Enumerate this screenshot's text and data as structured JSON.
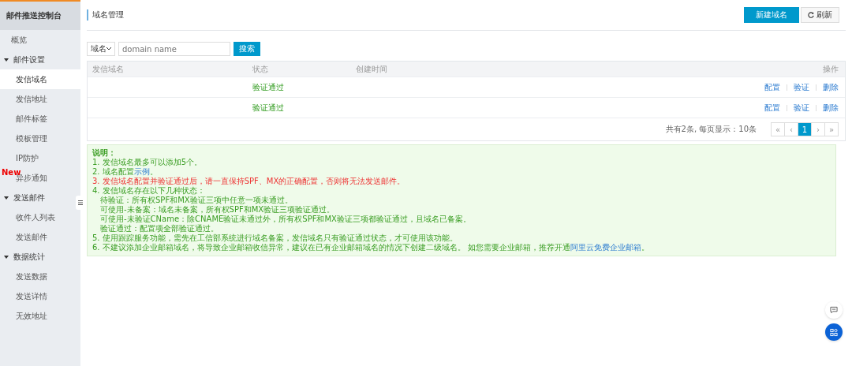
{
  "sidebar": {
    "title": "邮件推送控制台",
    "items": [
      {
        "label": "概览",
        "selected": false
      },
      {
        "label": "邮件设置",
        "expanded": true,
        "children": [
          {
            "label": "发信域名",
            "selected": true
          },
          {
            "label": "发信地址",
            "selected": false
          },
          {
            "label": "邮件标签",
            "selected": false
          },
          {
            "label": "模板管理",
            "selected": false
          },
          {
            "label": "IP防护",
            "selected": false
          },
          {
            "label": "异步通知",
            "selected": false,
            "badge": "New"
          }
        ]
      },
      {
        "label": "发送邮件",
        "expanded": true,
        "children": [
          {
            "label": "收件人列表",
            "selected": false
          },
          {
            "label": "发送邮件",
            "selected": false
          }
        ]
      },
      {
        "label": "数据统计",
        "expanded": true,
        "children": [
          {
            "label": "发送数据",
            "selected": false
          },
          {
            "label": "发送详情",
            "selected": false
          },
          {
            "label": "无效地址",
            "selected": false
          }
        ]
      }
    ]
  },
  "header": {
    "title": "域名管理",
    "buttons": [
      {
        "label": "新建域名",
        "kind": "primary"
      },
      {
        "label": "刷新",
        "kind": "refresh"
      }
    ]
  },
  "search": {
    "filter": "域名",
    "placeholder": "domain name",
    "button": "搜索"
  },
  "table": {
    "columns": [
      "发信域名",
      "状态",
      "创建时间",
      "操作"
    ],
    "rows": [
      {
        "status": "验证通过",
        "actions": [
          "配置",
          "验证",
          "删除"
        ]
      },
      {
        "status": "验证通过",
        "actions": [
          "配置",
          "验证",
          "删除"
        ]
      }
    ]
  },
  "pagination": {
    "summary": "共有2条, 每页显示：10条",
    "controls": [
      "«",
      "‹"
    ],
    "pages": [
      {
        "label": "1",
        "selected": true
      }
    ],
    "after": [
      "›",
      "»"
    ]
  },
  "notes": {
    "title": "说明：",
    "lines": [
      {
        "text": "1. 发信域名最多可以添加5个。",
        "kind": "normal"
      },
      {
        "text": "2. 域名配置",
        "link": "示例",
        "tail": "。",
        "kind": "normal"
      },
      {
        "text": "3. 发信域名配置并验证通过后，请一直保持SPF、MX的正确配置，否则将无法发送邮件。",
        "kind": "warning"
      },
      {
        "text": "4. 发信域名存在以下几种状态：",
        "kind": "normal"
      },
      {
        "text": "待验证：所有权SPF和MX验证三项中任意一项未通过。",
        "kind": "indent"
      },
      {
        "text": "可使用-未备案：域名未备案，所有权SPF和MX验证三项验证通过。",
        "kind": "indent"
      },
      {
        "text": "可使用-未验证CName：除CNAME验证未通过外，所有权SPF和MX验证三项都验证通过，且域名已备案。",
        "kind": "indent"
      },
      {
        "text": "验证通过：配置项全部验证通过。",
        "kind": "indent"
      },
      {
        "text": "5. 使用跟踪服务功能，需先在工信部系统进行域名备案，发信域名只有验证通过状态，才可使用该功能。",
        "kind": "normal"
      },
      {
        "text": "6. 不建议添加企业邮箱域名，将导致企业邮箱收信异常，建议在已有企业邮箱域名的情况下创建二级域名。 如您需要企业邮箱，推荐开通",
        "link": "阿里云免费企业邮箱",
        "tail": "。",
        "kind": "normal"
      }
    ]
  }
}
